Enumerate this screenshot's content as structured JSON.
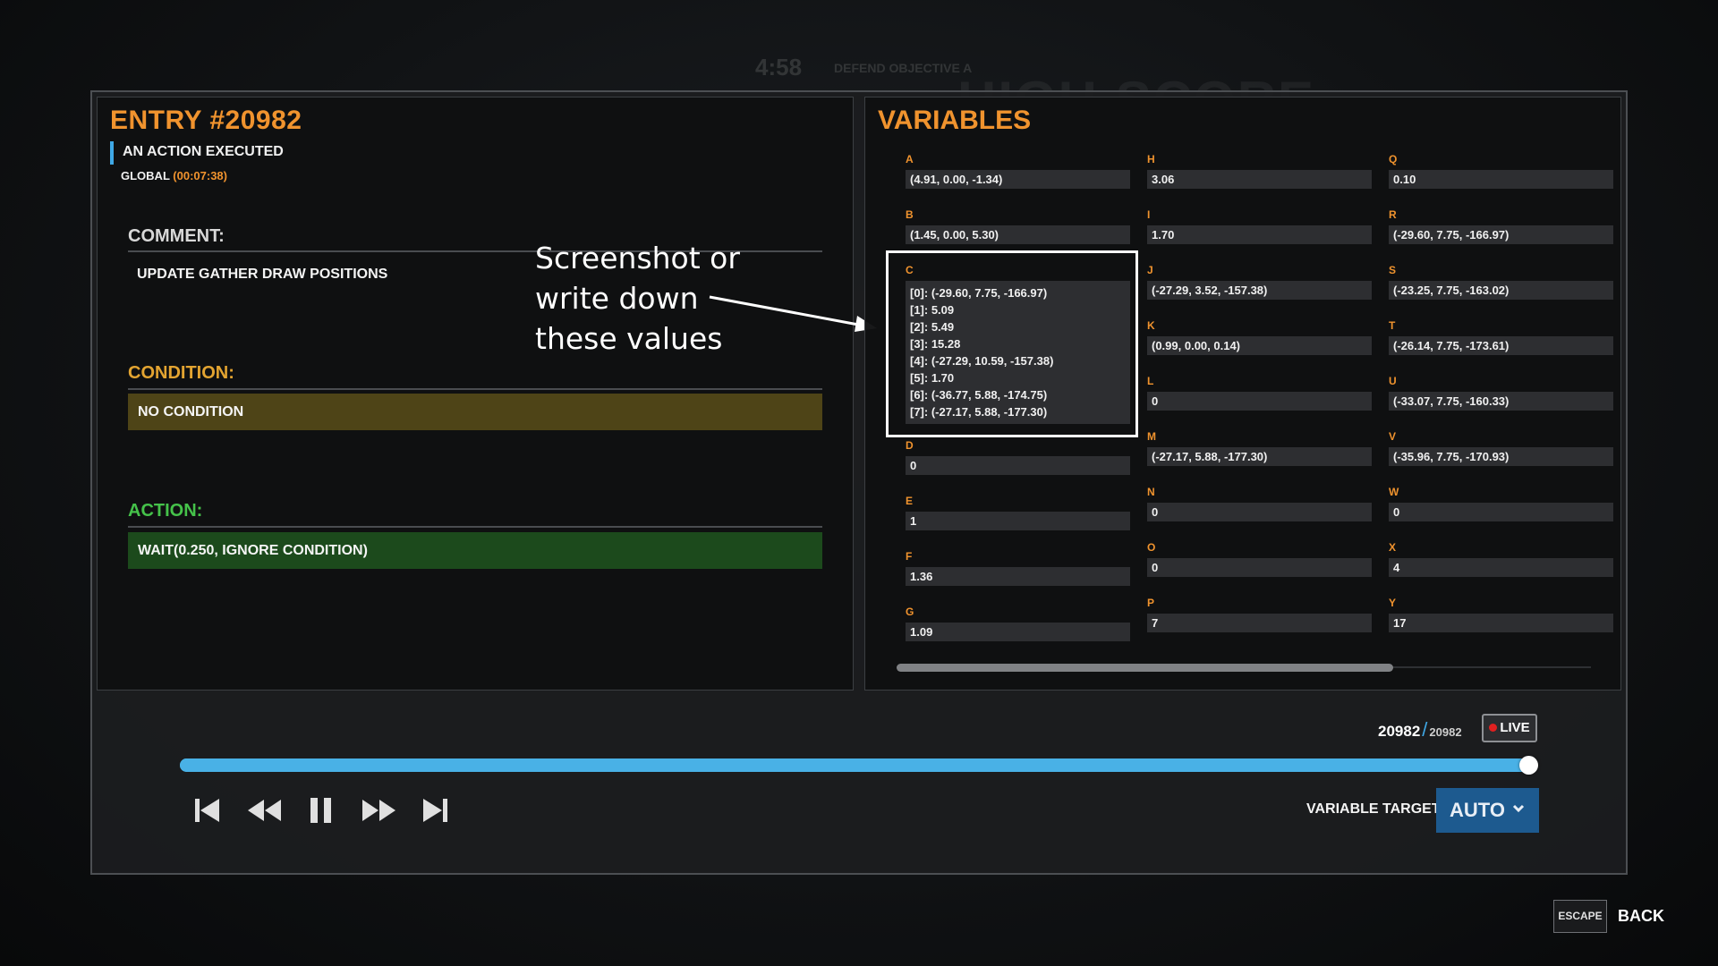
{
  "background_hud": {
    "timer": "4:58",
    "objective": "DEFEND OBJECTIVE A",
    "banner": "HIGH SCORE"
  },
  "entry": {
    "title": "ENTRY #20982",
    "event": "AN ACTION EXECUTED",
    "global_label": "GLOBAL",
    "global_time": "(00:07:38)"
  },
  "comment": {
    "label": "COMMENT:",
    "text": "UPDATE GATHER DRAW POSITIONS"
  },
  "condition": {
    "label": "CONDITION:",
    "text": "NO CONDITION"
  },
  "action": {
    "label": "ACTION:",
    "text": "WAIT(0.250, IGNORE CONDITION)"
  },
  "annotation": {
    "line1": "Screenshot or",
    "line2": "write down",
    "line3": "these values"
  },
  "variables": {
    "title": "VARIABLES",
    "col1": [
      {
        "name": "A",
        "value": "(4.91, 0.00, -1.34)"
      },
      {
        "name": "B",
        "value": "(1.45, 0.00, 5.30)"
      },
      {
        "name": "C",
        "list": [
          "[0]: (-29.60, 7.75, -166.97)",
          "[1]: 5.09",
          "[2]: 5.49",
          "[3]: 15.28",
          "[4]: (-27.29, 10.59, -157.38)",
          "[5]: 1.70",
          "[6]: (-36.77, 5.88, -174.75)",
          "[7]: (-27.17, 5.88, -177.30)"
        ]
      },
      {
        "name": "D",
        "value": "0"
      },
      {
        "name": "E",
        "value": "1"
      },
      {
        "name": "F",
        "value": "1.36"
      },
      {
        "name": "G",
        "value": "1.09"
      }
    ],
    "col2": [
      {
        "name": "H",
        "value": "3.06"
      },
      {
        "name": "I",
        "value": "1.70"
      },
      {
        "name": "J",
        "value": "(-27.29, 3.52, -157.38)"
      },
      {
        "name": "K",
        "value": "(0.99, 0.00, 0.14)"
      },
      {
        "name": "L",
        "value": "0"
      },
      {
        "name": "M",
        "value": "(-27.17, 5.88, -177.30)"
      },
      {
        "name": "N",
        "value": "0"
      },
      {
        "name": "O",
        "value": "0"
      },
      {
        "name": "P",
        "value": "7"
      }
    ],
    "col3": [
      {
        "name": "Q",
        "value": "0.10"
      },
      {
        "name": "R",
        "value": "(-29.60, 7.75, -166.97)"
      },
      {
        "name": "S",
        "value": "(-23.25, 7.75, -163.02)"
      },
      {
        "name": "T",
        "value": "(-26.14, 7.75, -173.61)"
      },
      {
        "name": "U",
        "value": "(-33.07, 7.75, -160.33)"
      },
      {
        "name": "V",
        "value": "(-35.96, 7.75, -170.93)"
      },
      {
        "name": "W",
        "value": "0"
      },
      {
        "name": "X",
        "value": "4"
      },
      {
        "name": "Y",
        "value": "17"
      }
    ]
  },
  "playback": {
    "current": "20982",
    "separator": "/",
    "total": "20982",
    "live_label": "LIVE",
    "progress": 1.0,
    "controls": {
      "first": "skip-to-start-icon",
      "rewind": "rewind-icon",
      "pause": "pause-icon",
      "forward": "fast-forward-icon",
      "last": "skip-to-end-icon"
    },
    "accent_color": "#49b1e6"
  },
  "variable_target": {
    "label": "VARIABLE TARGET",
    "value": "AUTO"
  },
  "footer": {
    "escape_key": "ESCAPE",
    "back_label": "BACK"
  },
  "colors": {
    "accent_orange": "#f0932e",
    "condition_bg": "#4e4417",
    "action_bg": "#1c4a1c",
    "button_blue": "#1d5a8f"
  }
}
